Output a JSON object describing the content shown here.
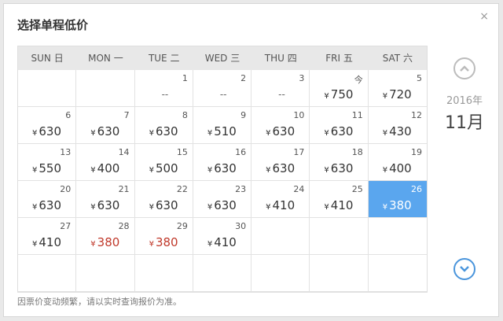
{
  "dialog": {
    "title": "选择单程低价",
    "close_label": "×",
    "note": "因票价变动频繁，请以实时查询报价为准。"
  },
  "weekdays": [
    "SUN 日",
    "MON 一",
    "TUE 二",
    "WED 三",
    "THU 四",
    "FRI 五",
    "SAT 六"
  ],
  "currency_symbol": "¥",
  "nav": {
    "year": "2016年",
    "month": "11月"
  },
  "colors": {
    "selected_bg": "#5aa6ee",
    "low_price": "#c0392b",
    "arrow_down": "#4a95dc",
    "arrow_up": "#bcbcbc"
  },
  "cells": [
    {
      "day": "",
      "price": "",
      "dash": false
    },
    {
      "day": "",
      "price": "",
      "dash": false
    },
    {
      "day": "1",
      "price": "",
      "dash": true
    },
    {
      "day": "2",
      "price": "",
      "dash": true
    },
    {
      "day": "3",
      "price": "",
      "dash": true
    },
    {
      "day": "今",
      "price": "750"
    },
    {
      "day": "5",
      "price": "720"
    },
    {
      "day": "6",
      "price": "630"
    },
    {
      "day": "7",
      "price": "630"
    },
    {
      "day": "8",
      "price": "630"
    },
    {
      "day": "9",
      "price": "510"
    },
    {
      "day": "10",
      "price": "630"
    },
    {
      "day": "11",
      "price": "630"
    },
    {
      "day": "12",
      "price": "430"
    },
    {
      "day": "13",
      "price": "550"
    },
    {
      "day": "14",
      "price": "400"
    },
    {
      "day": "15",
      "price": "500"
    },
    {
      "day": "16",
      "price": "630"
    },
    {
      "day": "17",
      "price": "630"
    },
    {
      "day": "18",
      "price": "630"
    },
    {
      "day": "19",
      "price": "400"
    },
    {
      "day": "20",
      "price": "630"
    },
    {
      "day": "21",
      "price": "630"
    },
    {
      "day": "22",
      "price": "630"
    },
    {
      "day": "23",
      "price": "630"
    },
    {
      "day": "24",
      "price": "410"
    },
    {
      "day": "25",
      "price": "410"
    },
    {
      "day": "26",
      "price": "380",
      "selected": true
    },
    {
      "day": "27",
      "price": "410"
    },
    {
      "day": "28",
      "price": "380",
      "red": true
    },
    {
      "day": "29",
      "price": "380",
      "red": true
    },
    {
      "day": "30",
      "price": "410"
    },
    {
      "day": "",
      "price": ""
    },
    {
      "day": "",
      "price": ""
    },
    {
      "day": "",
      "price": ""
    },
    {
      "day": "",
      "price": ""
    },
    {
      "day": "",
      "price": ""
    },
    {
      "day": "",
      "price": ""
    },
    {
      "day": "",
      "price": ""
    },
    {
      "day": "",
      "price": ""
    },
    {
      "day": "",
      "price": ""
    },
    {
      "day": "",
      "price": ""
    }
  ]
}
